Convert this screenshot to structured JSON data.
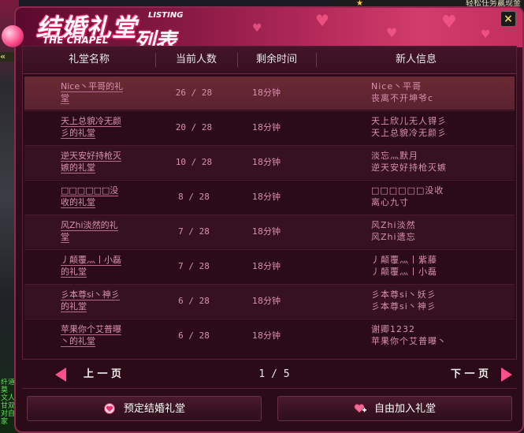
{
  "backdrop": {
    "top_right_text": "轻松任务赢现金",
    "left_chevrons": "«",
    "left_green_text": "纤道 莫 文人 甘双 对自 家"
  },
  "dialog": {
    "title_main": "结婚礼堂",
    "title_sub_en": "LISTING",
    "title_chapel": "THE CHAPEL",
    "title_list": "列表",
    "close_label": "×"
  },
  "table": {
    "headers": {
      "name": "礼堂名称",
      "count": "当前人数",
      "time": "剩余时间",
      "info": "新人信息"
    },
    "rows": [
      {
        "name_line1": "Nice丶平哥的礼",
        "name_line2": "堂",
        "count": "26 / 28",
        "time": "18分钟",
        "info_line1": "Nice丶平哥",
        "info_line2": "丧离不开坤爷c"
      },
      {
        "name_line1": "天上总貌冷无颜",
        "name_line2": "彡的礼堂",
        "count": "20 / 28",
        "time": "18分钟",
        "info_line1": "天上欣儿无人锝彡",
        "info_line2": "天上总貌冷无颜彡"
      },
      {
        "name_line1": "逆天安好持枪灭",
        "name_line2": "嫉的礼堂",
        "count": "10 / 28",
        "time": "18分钟",
        "info_line1": "淡忘灬默月",
        "info_line2": "逆天安好持枪灭嫉"
      },
      {
        "name_line1": "□□□□□□没",
        "name_line2": "收的礼堂",
        "count": "8 / 28",
        "time": "18分钟",
        "info_line1": "□□□□□□没收",
        "info_line2": "离心九寸"
      },
      {
        "name_line1": "风Zhi淡然的礼",
        "name_line2": "堂",
        "count": "7 / 28",
        "time": "18分钟",
        "info_line1": "风Zhi淡然",
        "info_line2": "风Zhi遗忘"
      },
      {
        "name_line1": "丿颠覆灬丨小磊",
        "name_line2": "的礼堂",
        "count": "7 / 28",
        "time": "18分钟",
        "info_line1": "丿颠覆灬丨紫藤",
        "info_line2": "丿颠覆灬丨小磊"
      },
      {
        "name_line1": "彡本尊si丶神彡",
        "name_line2": "的礼堂",
        "count": "6 / 28",
        "time": "18分钟",
        "info_line1": "彡本尊si丶妖彡",
        "info_line2": "彡本尊si丶神彡"
      },
      {
        "name_line1": "苹果你个艾普曝",
        "name_line2": "丶的礼堂",
        "count": "6 / 28",
        "time": "18分钟",
        "info_line1": "谢卿1232",
        "info_line2": "苹果你个艾普曝丶"
      }
    ]
  },
  "pager": {
    "prev_label": "上 一 页",
    "next_label": "下 一 页",
    "page_indicator": "1 / 5"
  },
  "buttons": {
    "reserve_label": "预定结婚礼堂",
    "join_label": "自由加入礼堂"
  },
  "colors": {
    "accent": "#ff4f8a",
    "row_text": "#d890ae",
    "header_band": "#b52a5a"
  }
}
